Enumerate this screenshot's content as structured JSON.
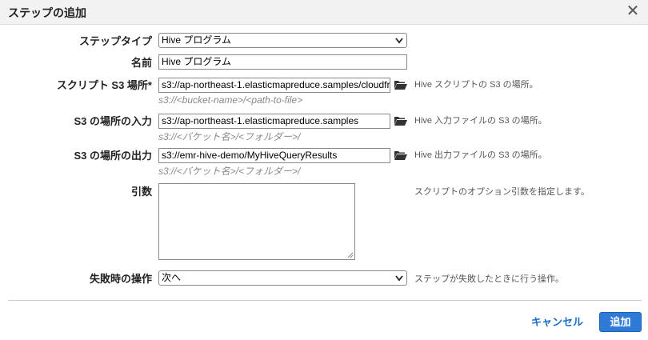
{
  "dialog": {
    "title": "ステップの追加",
    "close_icon": "close-icon"
  },
  "form": {
    "step_type": {
      "label": "ステップタイプ",
      "value": "Hive プログラム"
    },
    "name": {
      "label": "名前",
      "value": "Hive プログラム"
    },
    "script_location": {
      "label": "スクリプト S3 場所*",
      "value": "s3://ap-northeast-1.elasticmapreduce.samples/cloudfr",
      "sub": "s3://<bucket-name>/<path-to-file>",
      "hint": "Hive スクリプトの S3 の場所。"
    },
    "input_location": {
      "label": "S3 の場所の入力",
      "value": "s3://ap-northeast-1.elasticmapreduce.samples",
      "sub": "s3://<バケット名>/<フォルダー>/",
      "hint": "Hive 入力ファイルの S3 の場所。"
    },
    "output_location": {
      "label": "S3 の場所の出力",
      "value": " s3://emr-hive-demo/MyHiveQueryResults",
      "sub": "s3://<バケット名>/<フォルダー>/",
      "hint": "Hive 出力ファイルの S3 の場所。"
    },
    "arguments": {
      "label": "引数",
      "value": "",
      "hint": "スクリプトのオプション引数を指定します。"
    },
    "on_failure": {
      "label": "失敗時の操作",
      "value": "次へ",
      "hint": "ステップが失敗したときに行う操作。"
    }
  },
  "footer": {
    "cancel_label": "キャンセル",
    "add_label": "追加"
  },
  "colors": {
    "accent": "#2f7ad6",
    "link": "#1a6ec8",
    "header_bg": "#f2f2f2"
  }
}
